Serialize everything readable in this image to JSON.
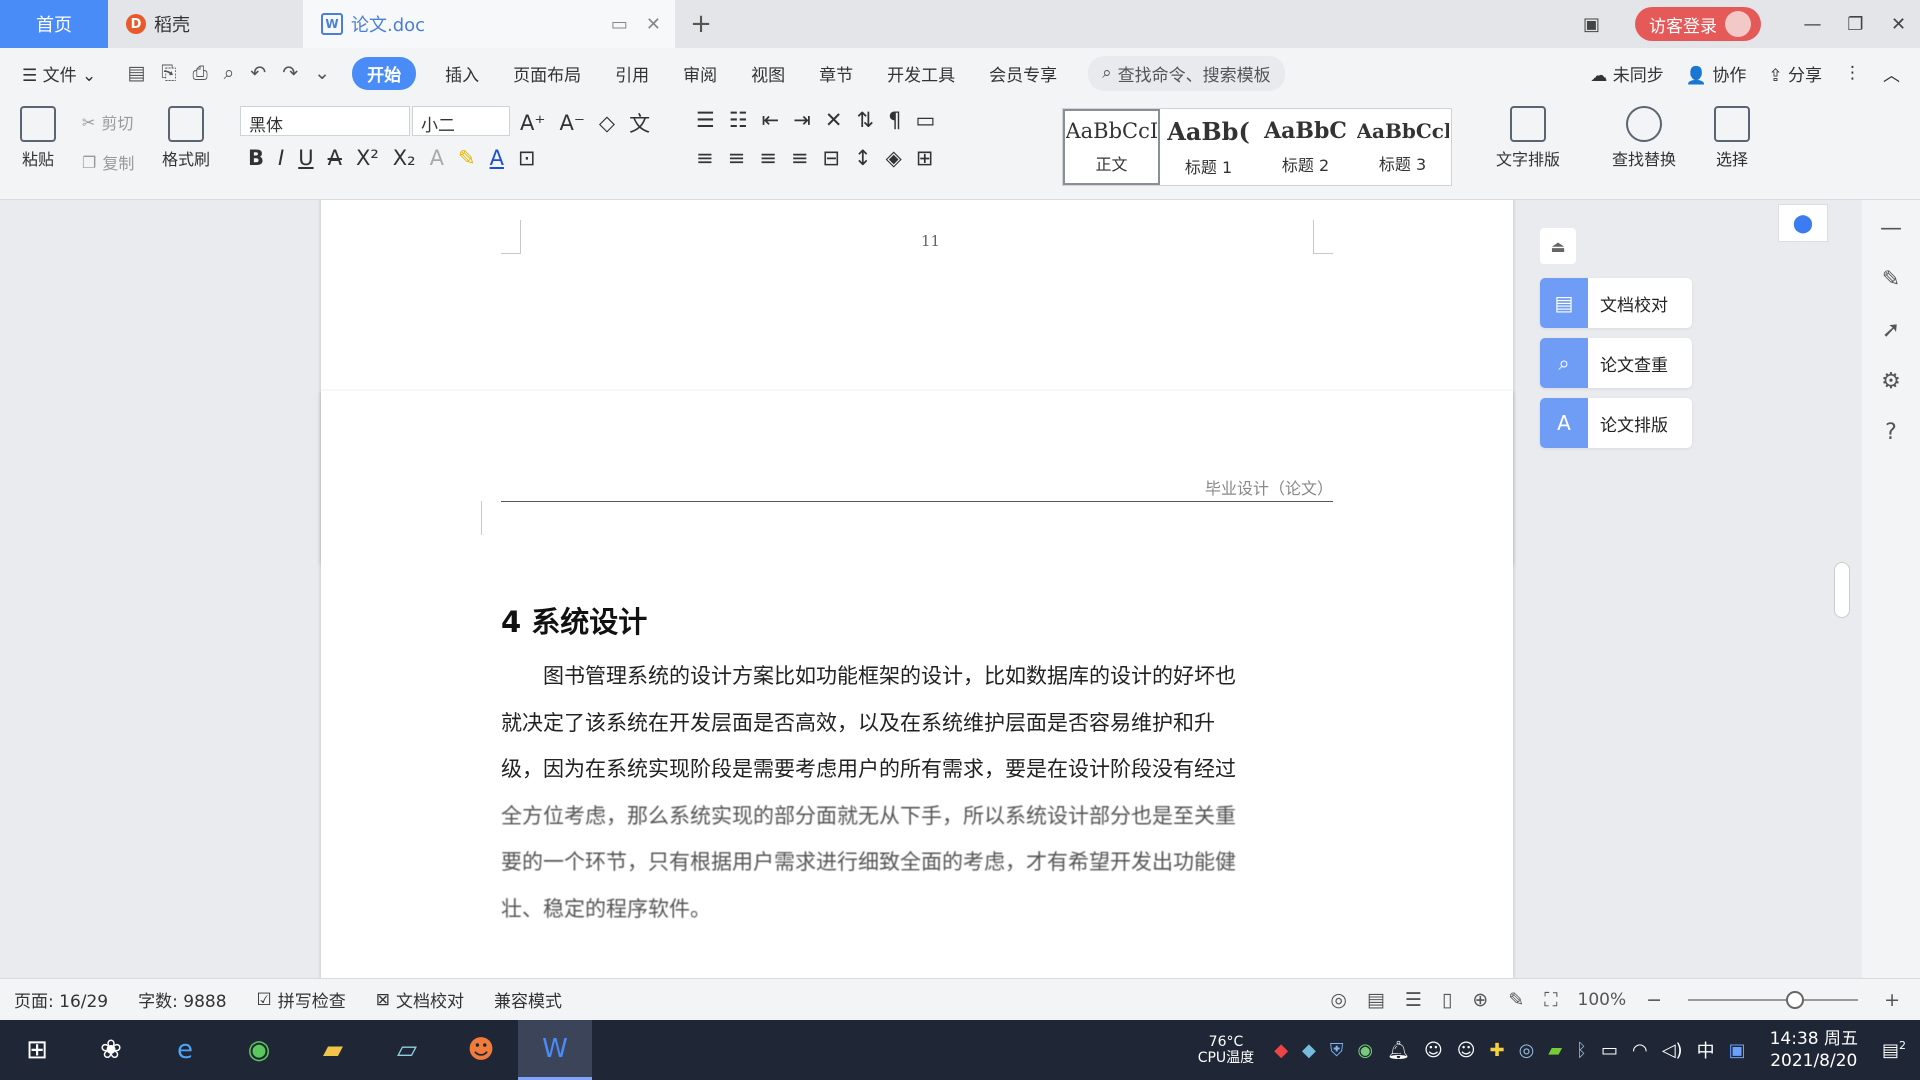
{
  "titlebar": {
    "tab_home": "首页",
    "tab_daoke": "稻壳",
    "tab_doc": "论文.doc",
    "doc_badge": "W",
    "daoke_badge": "D",
    "new_tab": "+",
    "login": "访客登录"
  },
  "menu": {
    "file": "文件",
    "tabs": [
      "开始",
      "插入",
      "页面布局",
      "引用",
      "审阅",
      "视图",
      "章节",
      "开发工具",
      "会员专享"
    ],
    "search_placeholder": "查找命令、搜索模板",
    "sync": "未同步",
    "collab": "协作",
    "share": "分享"
  },
  "ribbon": {
    "paste": "粘贴",
    "cut": "剪切",
    "copy": "复制",
    "format_painter": "格式刷",
    "font_name": "黑体",
    "font_size": "小二",
    "styles": [
      {
        "preview": "AaBbCcI",
        "name": "正文"
      },
      {
        "preview": "AaBb(",
        "name": "标题 1"
      },
      {
        "preview": "AaBbC",
        "name": "标题 2"
      },
      {
        "preview": "AaBbCcl",
        "name": "标题 3"
      }
    ],
    "text_layout": "文字排版",
    "find_replace": "查找替换",
    "select": "选择"
  },
  "document": {
    "page_number": "11",
    "header": "毕业设计（论文）",
    "heading": "4  系统设计",
    "paragraph_lines": [
      "　　图书管理系统的设计方案比如功能框架的设计，比如数据库的设计的好坏也",
      "就决定了该系统在开发层面是否高效，以及在系统维护层面是否容易维护和升",
      "级，因为在系统实现阶段是需要考虑用户的所有需求，要是在设计阶段没有经过",
      "全方位考虑，那么系统实现的部分面就无从下手，所以系统设计部分也是至关重",
      "要的一个环节，只有根据用户需求进行细致全面的考虑，才有希望开发出功能健",
      "壮、稳定的程序软件。"
    ]
  },
  "sidepanel": {
    "items": [
      "文档校对",
      "论文查重",
      "论文排版"
    ]
  },
  "statusbar": {
    "page": "页面: 16/29",
    "words": "字数: 9888",
    "spellcheck": "拼写检查",
    "doc_check": "文档校对",
    "compat": "兼容模式",
    "zoom": "100%"
  },
  "taskbar": {
    "cpu_temp": "76°C",
    "cpu_label": "CPU温度",
    "ime": "中",
    "time": "14:38 周五",
    "date": "2021/8/20",
    "notification_count": "2"
  },
  "colors": {
    "accent": "#4a8cf7",
    "login": "#e55a58",
    "side_icon": "#6f9cf5"
  }
}
